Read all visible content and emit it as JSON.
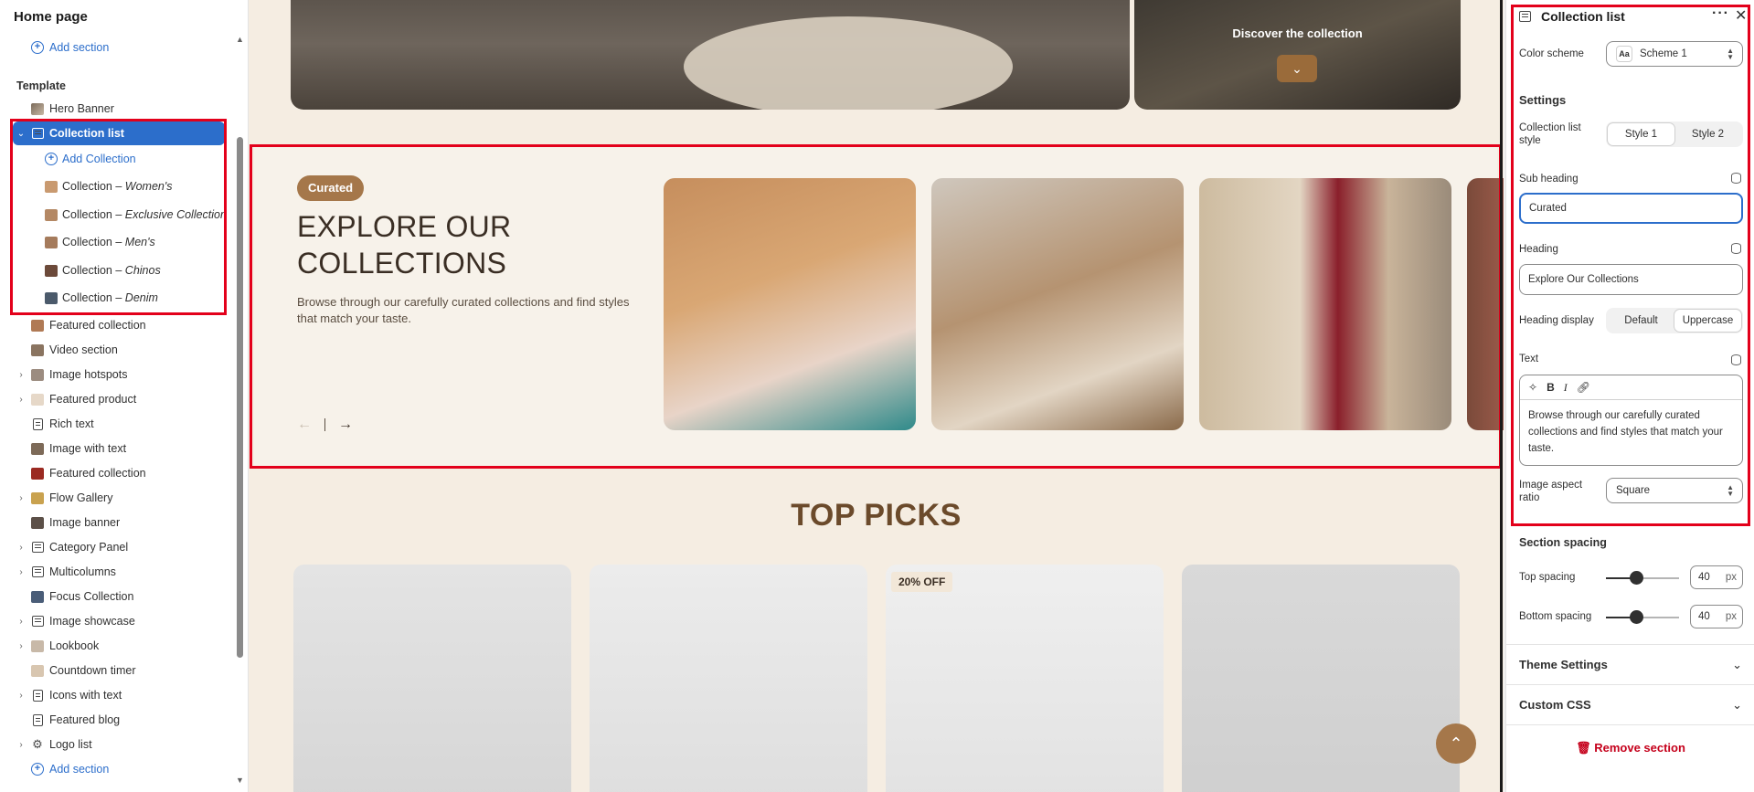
{
  "left_sidebar": {
    "title": "Home page",
    "add_section_top": "Add section",
    "template_label": "Template",
    "items": [
      {
        "label": "Hero Banner"
      },
      {
        "label": "Collection list"
      },
      {
        "label": "Add Collection"
      },
      {
        "label": "Collection",
        "sub": "– Women's"
      },
      {
        "label": "Collection",
        "sub": "– Exclusive Collection"
      },
      {
        "label": "Collection",
        "sub": "– Men's"
      },
      {
        "label": "Collection",
        "sub": "– Chinos"
      },
      {
        "label": "Collection",
        "sub": "– Denim"
      },
      {
        "label": "Featured collection"
      },
      {
        "label": "Video section"
      },
      {
        "label": "Image hotspots"
      },
      {
        "label": "Featured product"
      },
      {
        "label": "Rich text"
      },
      {
        "label": "Image with text"
      },
      {
        "label": "Featured collection"
      },
      {
        "label": "Flow Gallery"
      },
      {
        "label": "Image banner"
      },
      {
        "label": "Category Panel"
      },
      {
        "label": "Multicolumns"
      },
      {
        "label": "Focus Collection"
      },
      {
        "label": "Image showcase"
      },
      {
        "label": "Lookbook"
      },
      {
        "label": "Countdown timer"
      },
      {
        "label": "Icons with text"
      },
      {
        "label": "Featured blog"
      },
      {
        "label": "Logo list"
      }
    ],
    "add_section_bottom": "Add section"
  },
  "canvas": {
    "hero": {
      "discover_label": "Discover the collection",
      "discover_button_icon": "chevron-down-icon"
    },
    "collection_section": {
      "badge": "Curated",
      "heading": "EXPLORE OUR COLLECTIONS",
      "description": "Browse through our carefully curated collections and find styles that match your taste."
    },
    "top_picks": {
      "heading": "TOP PICKS",
      "sale_badge": "20% OFF"
    }
  },
  "right_panel": {
    "title": "Collection list",
    "color_scheme_label": "Color scheme",
    "color_scheme_icon_text": "Aa",
    "color_scheme_value": "Scheme 1",
    "settings_heading": "Settings",
    "collection_list_style_label": "Collection list style",
    "style_options": [
      "Style 1",
      "Style 2"
    ],
    "sub_heading_label": "Sub heading",
    "sub_heading_value": "Curated",
    "heading_label": "Heading",
    "heading_value": "Explore Our Collections",
    "heading_display_label": "Heading display",
    "heading_display_options": [
      "Default",
      "Uppercase"
    ],
    "text_label": "Text",
    "text_toolbar": [
      "B",
      "I"
    ],
    "text_value": "Browse through our carefully curated collections and find styles that match your taste.",
    "image_aspect_ratio_label": "Image aspect ratio",
    "image_aspect_ratio_value": "Square",
    "section_spacing_heading": "Section spacing",
    "top_spacing_label": "Top spacing",
    "top_spacing_value": "40",
    "bottom_spacing_label": "Bottom spacing",
    "bottom_spacing_value": "40",
    "spacing_unit": "px",
    "theme_settings": "Theme Settings",
    "custom_css": "Custom CSS",
    "remove_section": "Remove section"
  },
  "colors": {
    "accent_blue": "#2c6ecb",
    "highlight_red": "#e3001b",
    "brand_brown": "#a5774a",
    "canvas_bg": "#f5ede2"
  }
}
